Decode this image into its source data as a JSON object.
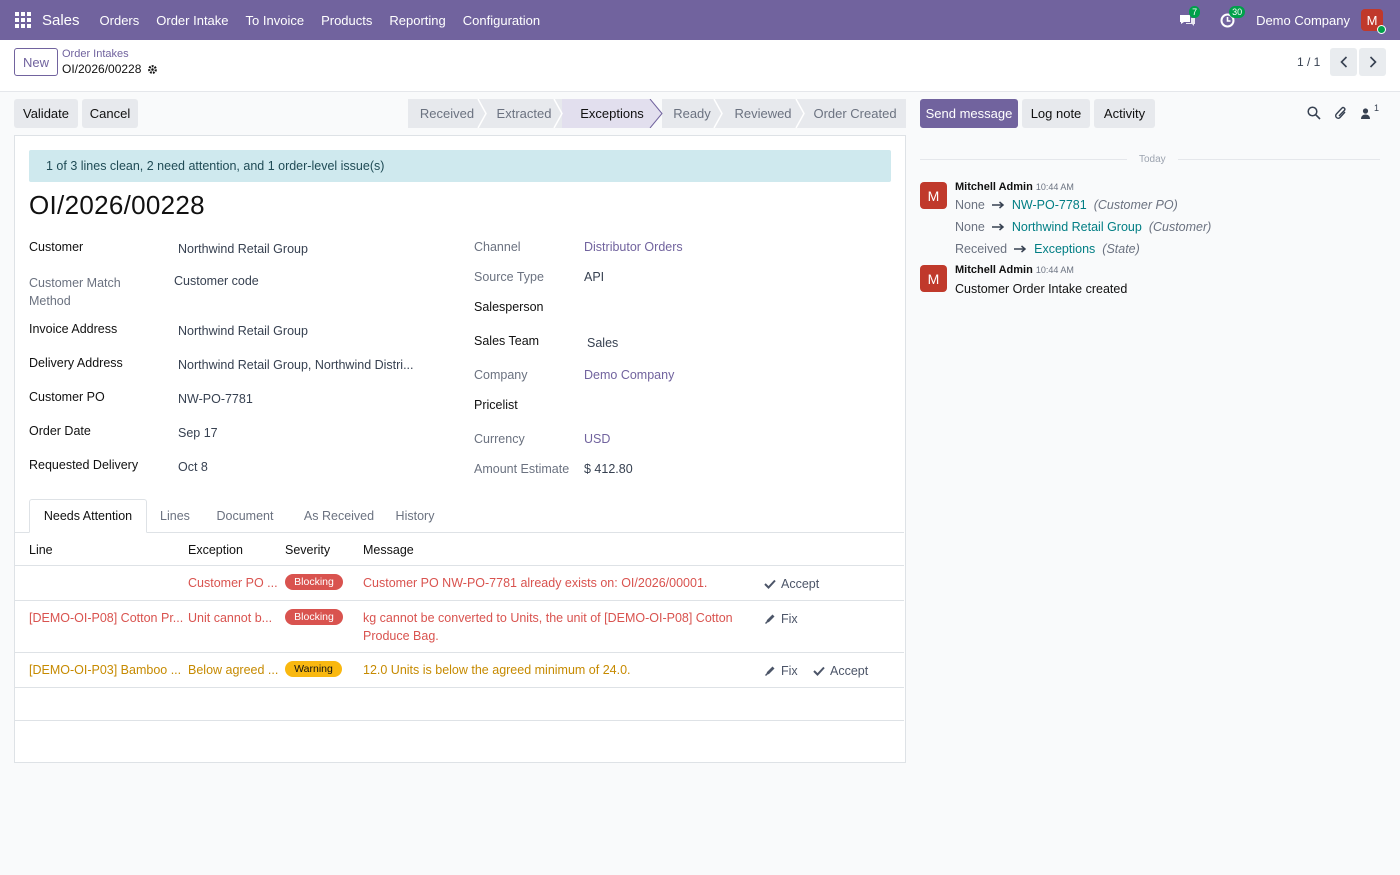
{
  "topbar": {
    "app_name": "Sales",
    "menu": [
      "Orders",
      "Order Intake",
      "To Invoice",
      "Products",
      "Reporting",
      "Configuration"
    ],
    "messages_count": "7",
    "activities_count": "30",
    "company": "Demo Company",
    "user_initial": "M"
  },
  "control_panel": {
    "new_label": "New",
    "breadcrumb_parent": "Order Intakes",
    "breadcrumb_current": "OI/2026/00228",
    "pager": "1 / 1"
  },
  "actions": {
    "validate": "Validate",
    "cancel": "Cancel"
  },
  "stages": [
    "Received",
    "Extracted",
    "Exceptions",
    "Ready",
    "Reviewed",
    "Order Created"
  ],
  "active_stage": "Exceptions",
  "chatter_buttons": {
    "send_message": "Send message",
    "log_note": "Log note",
    "activity": "Activity",
    "followers_count": "1"
  },
  "form": {
    "alert": "1 of 3 lines clean, 2 need attention, and 1 order-level issue(s)",
    "title": "OI/2026/00228",
    "left": [
      {
        "label": "Customer",
        "value": "Northwind Retail Group"
      },
      {
        "label": "Customer Match Method",
        "value": "Customer code"
      },
      {
        "label": "Invoice Address",
        "value": "Northwind Retail Group"
      },
      {
        "label": "Delivery Address",
        "value": "Northwind Retail Group, Northwind Distri..."
      },
      {
        "label": "Customer PO",
        "value": "NW-PO-7781"
      },
      {
        "label": "Order Date",
        "value": "Sep 17"
      },
      {
        "label": "Requested Delivery",
        "value": "Oct 8"
      }
    ],
    "right": [
      {
        "label": "Channel",
        "value": "Distributor Orders"
      },
      {
        "label": "Source Type",
        "value": "API"
      },
      {
        "label": "Salesperson",
        "value": ""
      },
      {
        "label": "Sales Team",
        "value": "Sales"
      },
      {
        "label": "Company",
        "value": "Demo Company"
      },
      {
        "label": "Pricelist",
        "value": ""
      },
      {
        "label": "Currency",
        "value": "USD"
      },
      {
        "label": "Amount Estimate",
        "value": "$ 412.80"
      }
    ]
  },
  "tabs": [
    "Needs Attention",
    "Lines",
    "Document",
    "As Received",
    "History"
  ],
  "table": {
    "headers": [
      "Line",
      "Exception",
      "Severity",
      "Message"
    ],
    "rows": [
      {
        "line": "",
        "exception": "Customer PO ...",
        "severity": "Blocking",
        "message": "Customer PO NW-PO-7781 already exists on: OI/2026/00001.",
        "actions": [
          "Accept"
        ]
      },
      {
        "line": "[DEMO-OI-P08] Cotton Pr...",
        "exception": "Unit cannot b...",
        "severity": "Blocking",
        "message_1": "kg cannot be converted to Units, the unit of [DEMO-OI-P08] Cotton",
        "message_2": "Produce Bag.",
        "actions": [
          "Fix"
        ]
      },
      {
        "line": "[DEMO-OI-P03] Bamboo ...",
        "exception": "Below agreed ...",
        "severity": "Warning",
        "message": "12.0 Units is below the agreed minimum of 24.0.",
        "actions": [
          "Fix",
          "Accept"
        ]
      }
    ]
  },
  "chatter": {
    "separator": "Today",
    "messages": [
      {
        "initial": "M",
        "author": "Mitchell Admin",
        "time": "10:44 AM",
        "tracking": [
          {
            "old": "None",
            "new": "NW-PO-7781",
            "field": "(Customer PO)"
          },
          {
            "old": "None",
            "new": "Northwind Retail Group",
            "field": "(Customer)"
          },
          {
            "old": "Received",
            "new": "Exceptions",
            "field": "(State)"
          }
        ]
      },
      {
        "initial": "M",
        "author": "Mitchell Admin",
        "time": "10:44 AM",
        "body": "Customer Order Intake created"
      }
    ]
  },
  "colors": {
    "brand": "#71639e",
    "danger": "#d9534f",
    "warning": "#f9b810",
    "alert_bg": "#cfe9ee",
    "tracking_link": "#017e84"
  },
  "icons": [
    "apps-grid-icon",
    "chat-bubbles-icon",
    "clock-activity-icon",
    "gear-icon",
    "chevron-left-icon",
    "chevron-right-icon",
    "search-icon",
    "paperclip-icon",
    "followers-icon",
    "check-icon",
    "pencil-icon",
    "arrow-right-icon"
  ]
}
